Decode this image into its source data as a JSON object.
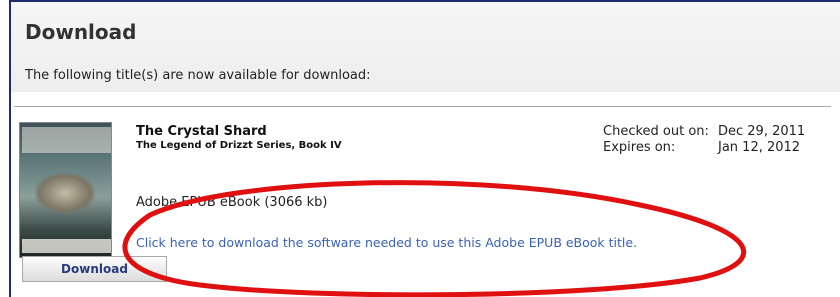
{
  "page": {
    "title": "Download",
    "intro": "The following title(s) are now available for download:"
  },
  "item": {
    "title": "The Crystal Shard",
    "series": "The Legend of Drizzt Series, Book IV",
    "format": "Adobe EPUB eBook (3066 kb)",
    "software_link": "Click here to download the software needed to use this Adobe EPUB eBook title.",
    "download_label": "Download",
    "checked_out_label": "Checked out on:",
    "checked_out_value": "Dec 29, 2011",
    "expires_label": "Expires on:",
    "expires_value": "Jan 12, 2012",
    "cover_author": "R.A. SALVATORE",
    "cover_title": "CRYSTAL SHARD"
  },
  "annotation": {
    "color": "#e01010"
  },
  "colors": {
    "frame": "#1f2d6b",
    "link": "#3a62b2"
  }
}
